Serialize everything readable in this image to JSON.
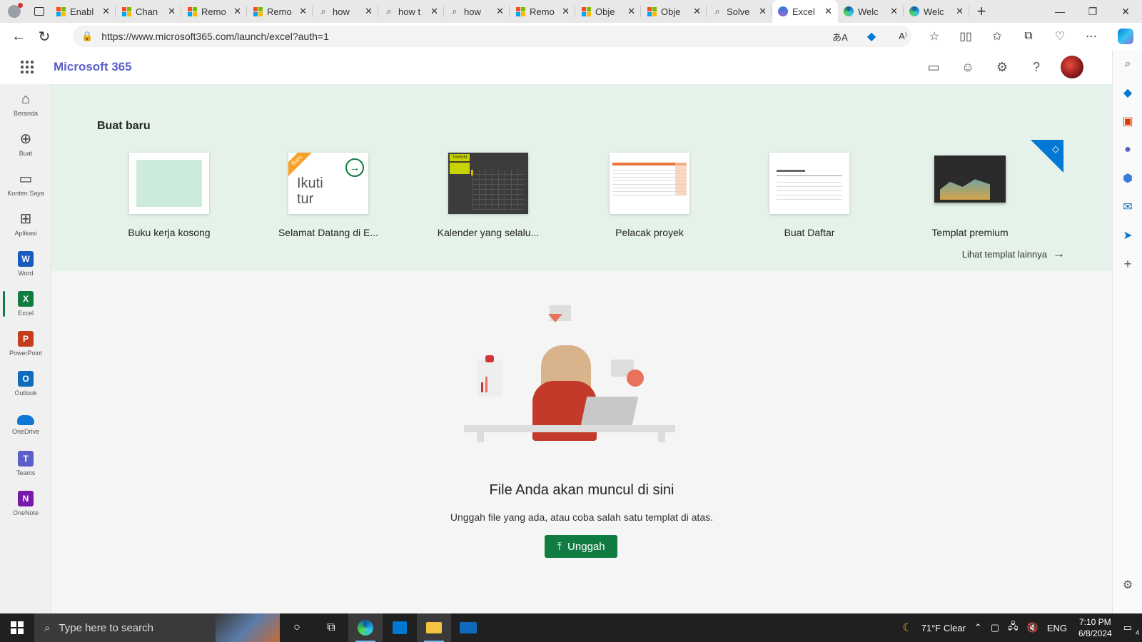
{
  "browser": {
    "tabs": [
      {
        "label": "Enabl",
        "icon": "ms-office-icon"
      },
      {
        "label": "Chan",
        "icon": "ms-office-icon"
      },
      {
        "label": "Remo",
        "icon": "ms-office-icon"
      },
      {
        "label": "Remo",
        "icon": "ms-office-icon"
      },
      {
        "label": "how",
        "icon": "search-icon"
      },
      {
        "label": "how t",
        "icon": "search-icon"
      },
      {
        "label": "how",
        "icon": "search-icon"
      },
      {
        "label": "Remo",
        "icon": "ms-office-icon"
      },
      {
        "label": "Obje",
        "icon": "ms-office-icon"
      },
      {
        "label": "Obje",
        "icon": "ms-office-icon"
      },
      {
        "label": "Solve",
        "icon": "search-icon"
      },
      {
        "label": "Excel",
        "icon": "copilot-icon",
        "active": true
      },
      {
        "label": "Welc",
        "icon": "edge-icon"
      },
      {
        "label": "Welc",
        "icon": "edge-icon"
      }
    ],
    "url": "https://www.microsoft365.com/launch/excel?auth=1"
  },
  "header": {
    "brand": "Microsoft 365"
  },
  "rail": {
    "items": [
      {
        "label": "Beranda",
        "icon": "home-icon"
      },
      {
        "label": "Buat",
        "icon": "create-icon"
      },
      {
        "label": "Konten Saya",
        "icon": "folder-icon"
      },
      {
        "label": "Aplikasi",
        "icon": "apps-icon"
      },
      {
        "label": "Word",
        "icon": "word-icon",
        "color": "#185abd",
        "letter": "W"
      },
      {
        "label": "Excel",
        "icon": "excel-icon",
        "color": "#107c41",
        "letter": "X"
      },
      {
        "label": "PowerPoint",
        "icon": "powerpoint-icon",
        "color": "#c43e1c",
        "letter": "P"
      },
      {
        "label": "Outlook",
        "icon": "outlook-icon",
        "color": "#0f6cbd",
        "letter": "O"
      },
      {
        "label": "OneDrive",
        "icon": "onedrive-icon"
      },
      {
        "label": "Teams",
        "icon": "teams-icon",
        "color": "#5b5fc7",
        "letter": "T"
      },
      {
        "label": "OneNote",
        "icon": "onenote-icon",
        "color": "#7719aa",
        "letter": "N"
      }
    ]
  },
  "create": {
    "heading": "Buat baru",
    "templates": [
      {
        "label": "Buku kerja kosong"
      },
      {
        "label": "Selamat Datang di E...",
        "badge": "Baru",
        "thumb_text_1": "Ikuti",
        "thumb_text_2": "tur"
      },
      {
        "label": "Kalender yang selalu...",
        "thumb_text": "TAHUN"
      },
      {
        "label": "Pelacak proyek"
      },
      {
        "label": "Buat Daftar"
      },
      {
        "label": "Templat premium"
      }
    ],
    "more_link": "Lihat templat lainnya"
  },
  "empty_state": {
    "title": "File Anda akan muncul di sini",
    "subtitle": "Unggah file yang ada, atau coba salah satu templat di atas.",
    "upload_button": "Unggah"
  },
  "taskbar": {
    "search_placeholder": "Type here to search",
    "weather": "71°F  Clear",
    "language": "ENG",
    "time": "7:10 PM",
    "date": "6/8/2024",
    "notification_count": "4"
  },
  "colors": {
    "brand": "#5b5fc7",
    "excel_green": "#107c41",
    "banner_bg": "#e5f2ea",
    "premium_blue": "#0078d4"
  }
}
